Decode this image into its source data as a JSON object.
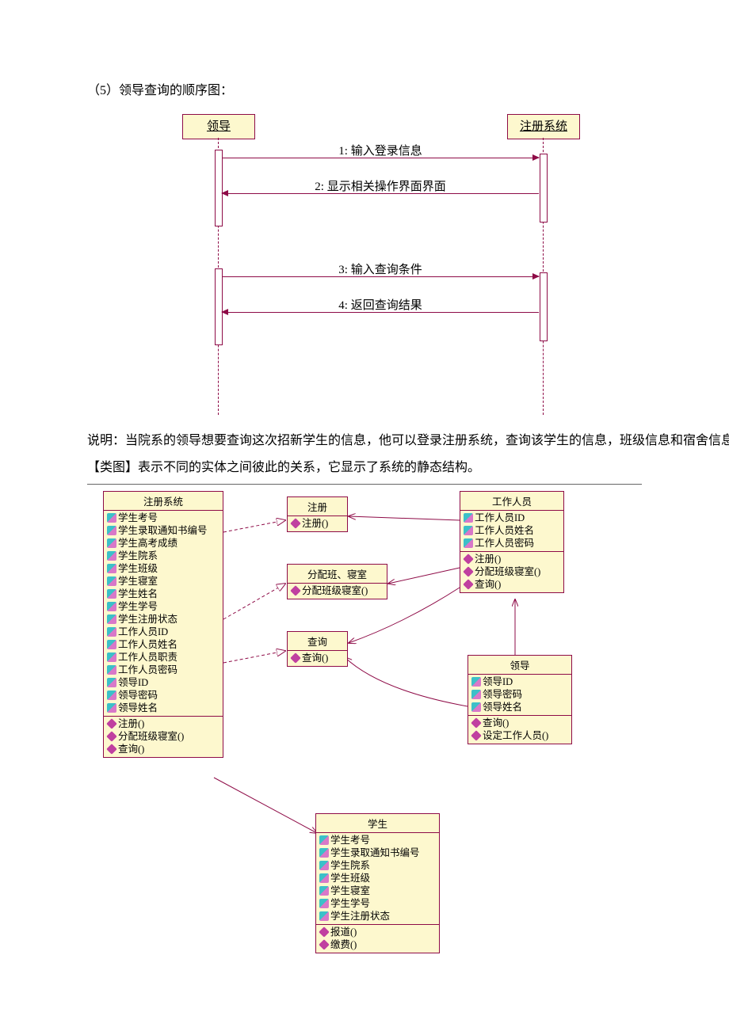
{
  "title": "（5）领导查询的顺序图：",
  "sequence": {
    "objects": {
      "left": "领导",
      "right": "注册系统"
    },
    "messages": {
      "m1": "1: 输入登录信息",
      "m2": "2: 显示相关操作界面界面",
      "m3": "3: 输入查询条件",
      "m4": "4: 返回查询结果"
    }
  },
  "explain1": "说明：当院系的领导想要查询这次招新学生的信息，他可以登录注册系统，查询该学生的信息，班级信息和宿舍信息。",
  "explain2": "【类图】表示不同的实体之间彼此的关系，它显示了系统的静态结构。",
  "classes": {
    "regsys": {
      "name": "注册系统",
      "attrs": [
        "学生考号",
        "学生录取通知书编号",
        "学生高考成绩",
        "学生院系",
        "学生班级",
        "学生寝室",
        "学生姓名",
        "学生学号",
        "学生注册状态",
        "工作人员ID",
        "工作人员姓名",
        "工作人员职责",
        "工作人员密码",
        "领导ID",
        "领导密码",
        "领导姓名"
      ],
      "ops": [
        "注册()",
        "分配班级寝室()",
        "查询()"
      ]
    },
    "register": {
      "name": "注册",
      "ops": [
        "注册()"
      ]
    },
    "assign": {
      "name": "分配班、寝室",
      "ops": [
        "分配班级寝室()"
      ]
    },
    "query": {
      "name": "查询",
      "ops": [
        "查询()"
      ]
    },
    "staff": {
      "name": "工作人员",
      "attrs": [
        "工作人员ID",
        "工作人员姓名",
        "工作人员密码"
      ],
      "ops": [
        "注册()",
        "分配班级寝室()",
        "查询()"
      ]
    },
    "leader": {
      "name": "领导",
      "attrs": [
        "领导ID",
        "领导密码",
        "领导姓名"
      ],
      "ops": [
        "查询()",
        "设定工作人员()"
      ]
    },
    "student": {
      "name": "学生",
      "attrs": [
        "学生考号",
        "学生录取通知书编号",
        "学生院系",
        "学生班级",
        "学生寝室",
        "学生学号",
        "学生注册状态"
      ],
      "ops": [
        "报道()",
        "缴费()"
      ]
    }
  }
}
